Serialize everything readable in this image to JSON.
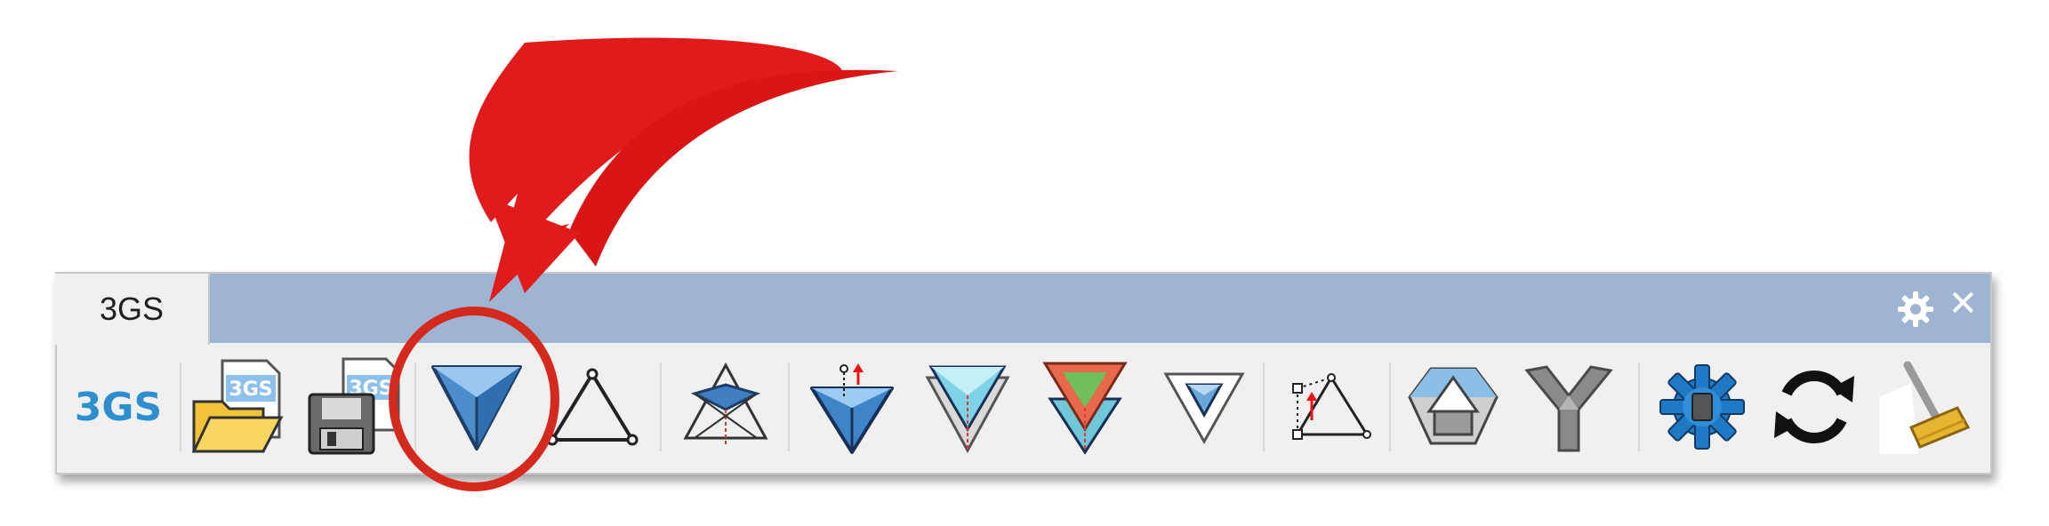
{
  "toolbar": {
    "tab_label": "3GS",
    "brand_label": "3GS",
    "buttons": [
      {
        "icon": "brand-3gs-icon"
      },
      {
        "icon": "open-file-icon",
        "badge": "3GS"
      },
      {
        "icon": "save-file-icon",
        "badge": "3GS"
      },
      {
        "icon": "form-diagram-icon"
      },
      {
        "icon": "triangle-icon"
      },
      {
        "icon": "force-diagram-icon"
      },
      {
        "icon": "edit-form-icon"
      },
      {
        "icon": "edit-force-icon"
      },
      {
        "icon": "compute-icon"
      },
      {
        "icon": "small-triangle-icon"
      },
      {
        "icon": "constraints-icon"
      },
      {
        "icon": "polyhedron-icon"
      },
      {
        "icon": "y-joint-icon"
      },
      {
        "icon": "settings-gear-icon"
      },
      {
        "icon": "refresh-icon"
      },
      {
        "icon": "clear-icon"
      }
    ]
  },
  "colors": {
    "tab_strip": "#9db5d3",
    "brand": "#2e8fd0",
    "annotation_red": "#e11b1b",
    "circle_red": "#d42a1e"
  }
}
